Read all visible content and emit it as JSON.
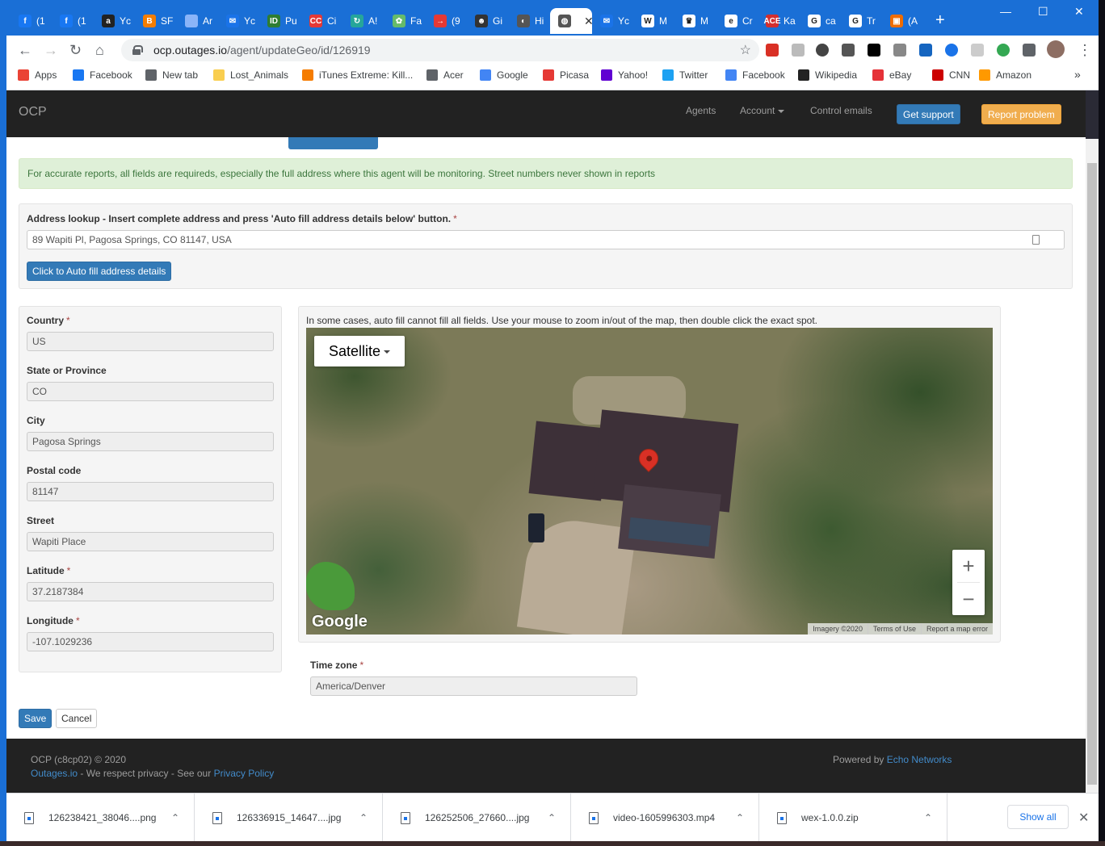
{
  "browser": {
    "tabs": [
      {
        "label": "(1",
        "color": "#1877f2",
        "glyph": "f"
      },
      {
        "label": "(1",
        "color": "#1877f2",
        "glyph": "f"
      },
      {
        "label": "Yc",
        "color": "#222",
        "glyph": "a"
      },
      {
        "label": "SF",
        "color": "#f57d00",
        "glyph": "B"
      },
      {
        "label": "Ar",
        "color": "#8ab4f8",
        "glyph": ""
      },
      {
        "label": "Yc",
        "color": "#1a73e8",
        "glyph": "✉"
      },
      {
        "label": "Pu",
        "color": "#2e7d32",
        "glyph": "ID"
      },
      {
        "label": "Ci",
        "color": "#e53935",
        "glyph": "CC"
      },
      {
        "label": "A!",
        "color": "#26a69a",
        "glyph": "↻"
      },
      {
        "label": "Fa",
        "color": "#66bb6a",
        "glyph": "✿"
      },
      {
        "label": "(9",
        "color": "#e53935",
        "glyph": "→"
      },
      {
        "label": "Gi",
        "color": "#333",
        "glyph": "☻"
      },
      {
        "label": "Hi",
        "color": "#555",
        "glyph": "◐"
      },
      {
        "label": "",
        "color": "#555",
        "glyph": "◍",
        "active": true
      },
      {
        "label": "Yc",
        "color": "#1a73e8",
        "glyph": "✉"
      },
      {
        "label": "M",
        "color": "#fff",
        "glyph": "W"
      },
      {
        "label": "M",
        "color": "#fff",
        "glyph": "♛"
      },
      {
        "label": "Cr",
        "color": "#fff",
        "glyph": "e"
      },
      {
        "label": "Ka",
        "color": "#d32f2f",
        "glyph": "ACE"
      },
      {
        "label": "ca",
        "color": "#fff",
        "glyph": "G"
      },
      {
        "label": "Tr",
        "color": "#fff",
        "glyph": "G"
      },
      {
        "label": "(A",
        "color": "#ef6c00",
        "glyph": "▣"
      }
    ],
    "new_tab": "+",
    "window_controls": {
      "minimize": "—",
      "maximize": "☐",
      "close": "✕"
    },
    "url_host": "ocp.outages.io",
    "url_path": "/agent/updateGeo/id/126919",
    "bookmarks": [
      {
        "label": "Apps",
        "color": "#ea4335"
      },
      {
        "label": "Facebook",
        "color": "#1877f2"
      },
      {
        "label": "New tab",
        "color": "#5f6368"
      },
      {
        "label": "Lost_Animals",
        "color": "#f9ce4f"
      },
      {
        "label": "iTunes Extreme: Kill...",
        "color": "#f57c00"
      },
      {
        "label": "Acer",
        "color": "#5f6368"
      },
      {
        "label": "Google",
        "color": "#4285f4"
      },
      {
        "label": "Picasa",
        "color": "#e53935"
      },
      {
        "label": "Yahoo!",
        "color": "#6001d2"
      },
      {
        "label": "Twitter",
        "color": "#1da1f2"
      },
      {
        "label": "Facebook",
        "color": "#4285f4"
      },
      {
        "label": "Wikipedia",
        "color": "#222"
      },
      {
        "label": "eBay",
        "color": "#e53238"
      },
      {
        "label": "CNN",
        "color": "#cc0000"
      },
      {
        "label": "Amazon",
        "color": "#ff9900"
      }
    ],
    "bookmarks_more": "»"
  },
  "navbar": {
    "brand": "OCP",
    "links": [
      "Agents",
      "Account",
      "Control emails"
    ],
    "support_label": "Get support",
    "report_label": "Report problem"
  },
  "alert": "For accurate reports, all fields are requireds, especially the full address where this agent will be monitoring. Street numbers never shown in reports",
  "lookup": {
    "label": "Address lookup - Insert complete address and press 'Auto fill address details below' button.",
    "value": "89 Wapiti Pl, Pagosa Springs, CO 81147, USA",
    "button": "Click to Auto fill address details"
  },
  "fields": [
    {
      "label": "Country",
      "value": "US",
      "required": true
    },
    {
      "label": "State or Province",
      "value": "CO",
      "required": false
    },
    {
      "label": "City",
      "value": "Pagosa Springs",
      "required": false
    },
    {
      "label": "Postal code",
      "value": "81147",
      "required": false
    },
    {
      "label": "Street",
      "value": "Wapiti Place",
      "required": false
    },
    {
      "label": "Latitude",
      "value": "37.2187384",
      "required": true
    },
    {
      "label": "Longitude",
      "value": "-107.1029236",
      "required": true
    }
  ],
  "map": {
    "hint": "In some cases, auto fill cannot fill all fields. Use your mouse to zoom in/out of the map, then double click the exact spot.",
    "type_label": "Satellite",
    "zoom_in": "+",
    "zoom_out": "−",
    "logo": "Google",
    "attribution": [
      "Imagery ©2020",
      "Terms of Use",
      "Report a map error"
    ]
  },
  "timezone": {
    "label": "Time zone",
    "value": "America/Denver"
  },
  "actions": {
    "save": "Save",
    "cancel": "Cancel"
  },
  "footer": {
    "copyright": "OCP (c8cp02) © 2020",
    "site_link": "Outages.io",
    "privacy_text": " - We respect privacy - See our ",
    "privacy_link": "Privacy Policy",
    "powered_text": "Powered by ",
    "powered_link": "Echo Networks"
  },
  "downloads": {
    "items": [
      "126238421_38046....png",
      "126336915_14647....jpg",
      "126252506_27660....jpg",
      "video-1605996303.mp4",
      "wex-1.0.0.zip"
    ],
    "show_all": "Show all"
  }
}
